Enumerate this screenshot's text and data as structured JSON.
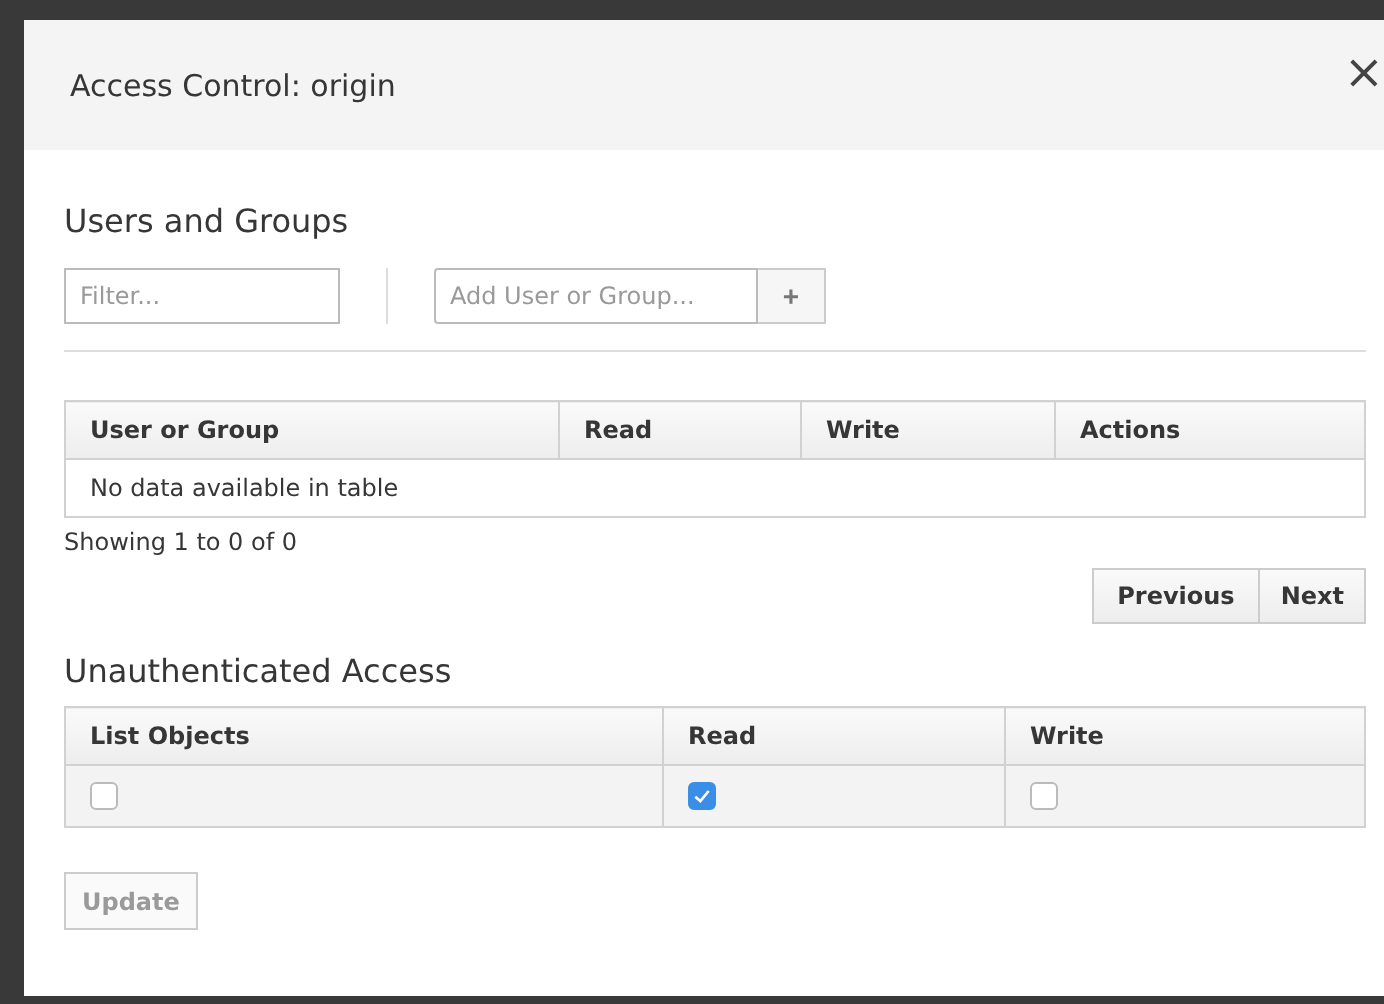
{
  "dialog": {
    "title": "Access Control: origin",
    "close": "×"
  },
  "users_and_groups": {
    "heading": "Users and Groups",
    "filter": {
      "placeholder": "Filter..."
    },
    "add": {
      "placeholder": "Add User or Group...",
      "button": "+"
    },
    "table": {
      "columns": [
        "User or Group",
        "Read",
        "Write",
        "Actions"
      ],
      "empty_message": "No data available in table"
    },
    "info": "Showing 1 to 0 of 0",
    "pagination": [
      "Previous",
      "Next"
    ]
  },
  "unauthenticated_access": {
    "heading": "Unauthenticated Access",
    "columns": [
      "List Objects",
      "Read",
      "Write"
    ],
    "checkboxes": [
      {
        "checked": false
      },
      {
        "checked": true
      },
      {
        "checked": false
      }
    ]
  },
  "update_button": {
    "label": "Update",
    "disabled": true
  }
}
